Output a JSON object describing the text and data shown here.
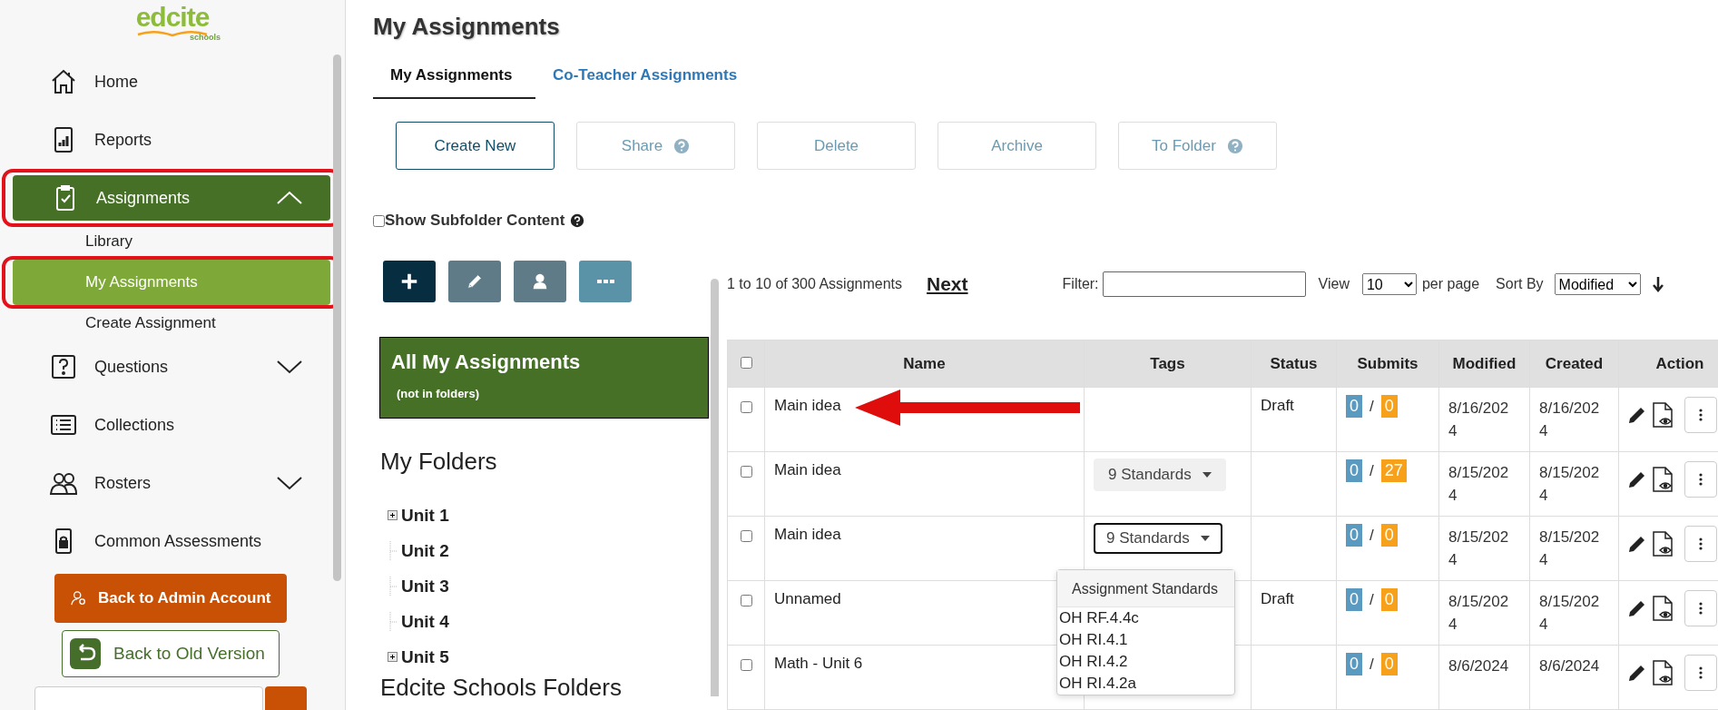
{
  "sidebar": {
    "logo": {
      "text": "edcite",
      "sub": "schools"
    },
    "items": [
      {
        "label": "Home",
        "kind": "home",
        "selected": false,
        "outlined": false
      },
      {
        "label": "Reports",
        "kind": "reports",
        "selected": false,
        "outlined": false
      },
      {
        "label": "Assignments",
        "kind": "clipboard",
        "selected": true,
        "outlined": true,
        "expanded": true,
        "children": [
          {
            "label": "Library",
            "selected": false,
            "outlined": false
          },
          {
            "label": "My Assignments",
            "selected": true,
            "outlined": true
          },
          {
            "label": "Create Assignment",
            "selected": false,
            "outlined": false
          }
        ]
      },
      {
        "label": "Questions",
        "kind": "question",
        "selected": false,
        "outlined": false,
        "expanded": false
      },
      {
        "label": "Collections",
        "kind": "list",
        "selected": false,
        "outlined": false
      },
      {
        "label": "Rosters",
        "kind": "people",
        "selected": false,
        "outlined": false,
        "expanded": false
      },
      {
        "label": "Common Assessments",
        "kind": "lock",
        "selected": false,
        "outlined": false
      }
    ],
    "admin_button": "Back to Admin Account",
    "old_version_button": "Back to Old Version"
  },
  "page": {
    "title": "My Assignments",
    "tabs": [
      {
        "label": "My Assignments",
        "selected": true
      },
      {
        "label": "Co-Teacher Assignments",
        "selected": false
      }
    ],
    "actions": [
      {
        "label": "Create New",
        "disabled": false,
        "help": false
      },
      {
        "label": "Share",
        "disabled": true,
        "help": true
      },
      {
        "label": "Delete",
        "disabled": true,
        "help": false
      },
      {
        "label": "Archive",
        "disabled": true,
        "help": false
      },
      {
        "label": "To Folder",
        "disabled": true,
        "help": true
      }
    ],
    "subfolder": {
      "label": "Show Subfolder Content",
      "checked": false
    },
    "folder_tools": [
      {
        "kind": "add"
      },
      {
        "kind": "edit"
      },
      {
        "kind": "share"
      },
      {
        "kind": "more"
      }
    ],
    "all_box": {
      "title": "All My Assignments",
      "sub": "(not in folders)"
    },
    "folders_title": "My Folders",
    "folders": [
      {
        "label": "Unit 1",
        "has_children": true
      },
      {
        "label": "Unit 2",
        "has_children": false
      },
      {
        "label": "Unit 3",
        "has_children": false
      },
      {
        "label": "Unit 4",
        "has_children": false
      },
      {
        "label": "Unit 5",
        "has_children": true
      }
    ],
    "schools_folders_title": "Edcite Schools Folders"
  },
  "listing": {
    "range": "1 to 10 of 300 Assignments",
    "next": "Next",
    "filter_label": "Filter:",
    "view_label": "View",
    "view_value": "10",
    "per_page": "per page",
    "sort_label": "Sort By",
    "sort_value": "Modified"
  },
  "table": {
    "header_checked": false,
    "submits_separator": "/",
    "columns": [
      "Name",
      "Tags",
      "Status",
      "Submits",
      "Modified",
      "Created",
      "Action"
    ],
    "rows": [
      {
        "checked": false,
        "name": "Main idea",
        "tags": null,
        "status": "Draft",
        "submitted": "0",
        "total": "0",
        "modified": "8/16/2024",
        "created": "8/16/2024",
        "arrow": true
      },
      {
        "checked": false,
        "name": "Main idea",
        "tags": {
          "label": "9 Standards",
          "open": false
        },
        "status": "",
        "submitted": "0",
        "total": "27",
        "modified": "8/15/2024",
        "created": "8/15/2024",
        "arrow": false
      },
      {
        "checked": false,
        "name": "Main idea",
        "tags": {
          "label": "9 Standards",
          "open": true
        },
        "status": "",
        "submitted": "0",
        "total": "0",
        "modified": "8/15/2024",
        "created": "8/15/2024",
        "arrow": false
      },
      {
        "checked": false,
        "name": "Unnamed",
        "tags": null,
        "status": "Draft",
        "submitted": "0",
        "total": "0",
        "modified": "8/15/2024",
        "created": "8/15/2024",
        "arrow": false
      },
      {
        "checked": false,
        "name": "Math - Unit 6",
        "tags": null,
        "status": "",
        "submitted": "0",
        "total": "0",
        "modified": "8/6/2024",
        "created": "8/6/2024",
        "arrow": false
      }
    ]
  },
  "standards_popover": {
    "title": "Assignment Standards",
    "items": [
      "OH RF.4.4c",
      "OH RI.4.1",
      "OH RI.4.2",
      "OH RI.4.2a"
    ]
  }
}
